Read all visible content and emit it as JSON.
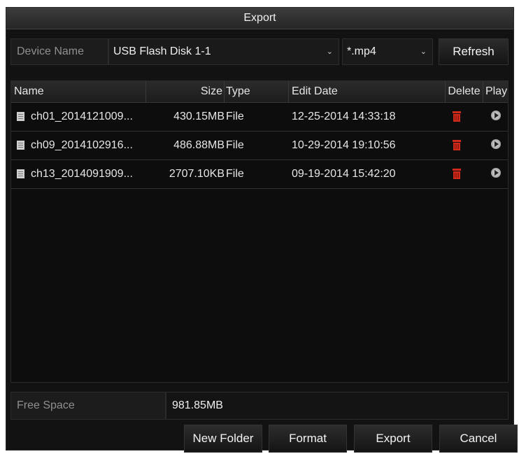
{
  "dialog": {
    "title": "Export"
  },
  "device": {
    "label": "Device Name",
    "selected": "USB Flash Disk 1-1",
    "filter": "*.mp4",
    "refresh_label": "Refresh"
  },
  "table": {
    "headers": {
      "name": "Name",
      "size": "Size",
      "type": "Type",
      "edit_date": "Edit Date",
      "delete": "Delete",
      "play": "Play"
    },
    "rows": [
      {
        "name": "ch01_2014121009...",
        "size": "430.15MB",
        "type": "File",
        "edit_date": "12-25-2014 14:33:18"
      },
      {
        "name": "ch09_2014102916...",
        "size": "486.88MB",
        "type": "File",
        "edit_date": "10-29-2014 19:10:56"
      },
      {
        "name": "ch13_2014091909...",
        "size": "2707.10KB",
        "type": "File",
        "edit_date": "09-19-2014 15:42:20"
      }
    ]
  },
  "free_space": {
    "label": "Free Space",
    "value": "981.85MB"
  },
  "buttons": {
    "new_folder": "New Folder",
    "format": "Format",
    "export": "Export",
    "cancel": "Cancel"
  },
  "colors": {
    "delete_icon": "#d12a1a",
    "background": "#121212"
  },
  "icons": {
    "file": "file-icon",
    "delete": "trash-icon",
    "play": "play-icon",
    "dropdown": "chevron-down-icon"
  }
}
